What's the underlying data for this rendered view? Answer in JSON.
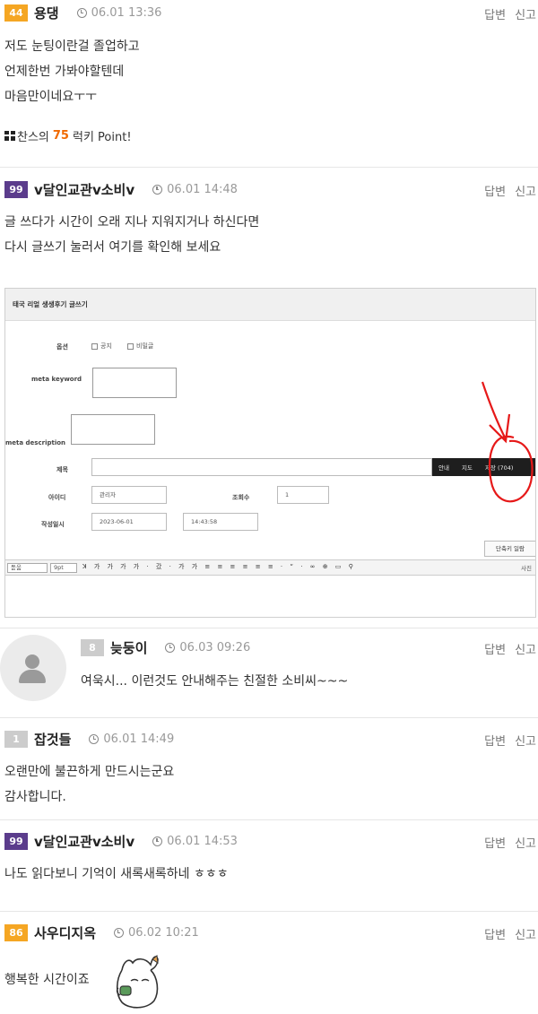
{
  "actions": {
    "reply": "답변",
    "report": "신고"
  },
  "colors": {
    "level_orange": "#f5a623",
    "level_purple": "#5b3c8c",
    "level_gray": "#cccccc",
    "luck_orange": "#f06a00"
  },
  "comments": [
    {
      "level": "44",
      "nick": "용댕",
      "time": "06.01 13:36",
      "lines": [
        "저도 눈팅이란걸 졸업하고",
        "언제한번 가봐야할텐데",
        "마음만이네요ㅜㅜ"
      ],
      "luck": {
        "prefix": "찬스의",
        "number": "75",
        "suffix": "럭키 Point!",
        "icon": "gift-icon"
      }
    },
    {
      "level": "99",
      "nick": "v달인교관v소비v",
      "time": "06.01 14:48",
      "lines": [
        "글 쓰다가 시간이 오래 지나 지워지거나 하신다면",
        "다시 글쓰기 눌러서 여기를 확인해 보세요"
      ],
      "image": {
        "title": "태국 리얼 생생후기 글쓰기",
        "option_label": "옵션",
        "opt1": "공지",
        "opt2": "비밀글",
        "meta_keyword": "meta keyword",
        "meta_description": "meta description",
        "subject_label": "제목",
        "guide": "안내",
        "map": "지도",
        "save": "저장 (704)",
        "id_label": "아이디",
        "id_value": "관리자",
        "views_label": "조회수",
        "views_value": "1",
        "date_label": "작성일시",
        "date_value": "2023-06-01",
        "time_value": "14:43:58",
        "shortcut": "단축키 일람",
        "font": "돋움",
        "size": "9pt",
        "photo": "사진"
      }
    },
    {
      "level": "8",
      "nick": "늦둥이",
      "time": "06.03 09:26",
      "lines": [
        "여욱시... 이런것도 안내해주는 친절한 소비씨~~~"
      ]
    },
    {
      "level": "1",
      "nick": "잡것들",
      "time": "06.01 14:49",
      "lines": [
        "오랜만에 불끈하게 만드시는군요",
        "감사합니다."
      ]
    },
    {
      "level": "99",
      "nick": "v달인교관v소비v",
      "time": "06.01 14:53",
      "lines": [
        "나도 읽다보니 기억이 새록새록하네 ㅎㅎㅎ"
      ]
    },
    {
      "level": "86",
      "nick": "사우디지옥",
      "time": "06.02 10:21",
      "lines": [
        "행복한 시간이죠"
      ]
    }
  ]
}
